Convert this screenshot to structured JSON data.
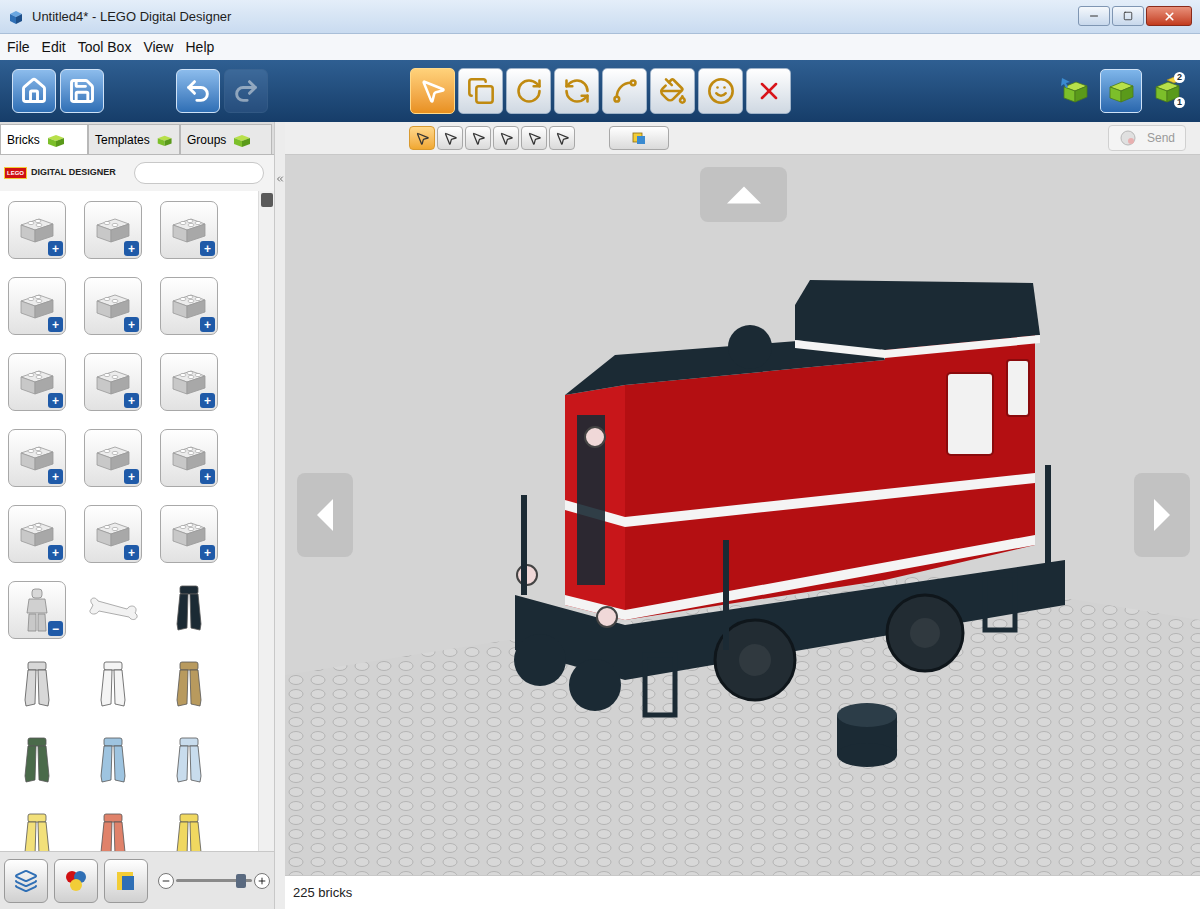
{
  "window": {
    "title": "Untitled4* - LEGO Digital Designer"
  },
  "menu": [
    "File",
    "Edit",
    "Tool Box",
    "View",
    "Help"
  ],
  "toolbar": {
    "actions": [
      {
        "kind": "home",
        "disabled": false
      },
      {
        "kind": "save",
        "disabled": false
      },
      {
        "kind": "undo",
        "disabled": false
      },
      {
        "kind": "redo",
        "disabled": true
      }
    ],
    "tools": [
      {
        "kind": "select",
        "selected": true
      },
      {
        "kind": "clone",
        "selected": false
      },
      {
        "kind": "hinge",
        "selected": false
      },
      {
        "kind": "hinge-align",
        "selected": false
      },
      {
        "kind": "flex",
        "selected": false
      },
      {
        "kind": "paint",
        "selected": false
      },
      {
        "kind": "hide",
        "selected": false
      },
      {
        "kind": "delete",
        "selected": false
      }
    ],
    "modes": [
      {
        "kind": "build",
        "selected": false,
        "badges": []
      },
      {
        "kind": "view",
        "selected": true,
        "badges": []
      },
      {
        "kind": "instructions",
        "selected": false,
        "badges": [
          "2",
          "1"
        ]
      }
    ]
  },
  "selection_modes": [
    {
      "kind": "single",
      "selected": true
    },
    {
      "kind": "connected",
      "selected": false
    },
    {
      "kind": "color",
      "selected": false
    },
    {
      "kind": "shape",
      "selected": false
    },
    {
      "kind": "color-shape",
      "selected": false
    },
    {
      "kind": "invert",
      "selected": false
    },
    {
      "kind": "filter",
      "selected": false
    }
  ],
  "send_button": {
    "label": "Send",
    "disabled": true
  },
  "tabs": [
    {
      "label": "Bricks",
      "selected": true
    },
    {
      "label": "Templates",
      "selected": false
    },
    {
      "label": "Groups",
      "selected": false
    }
  ],
  "brand": {
    "logo": "LEGO",
    "label": "DIGITAL DESIGNER"
  },
  "search": {
    "value": ""
  },
  "palette": [
    {
      "kind": "category",
      "badge": "+",
      "color": "#c8c8c8"
    },
    {
      "kind": "category",
      "badge": "+",
      "color": "#c8c8c8"
    },
    {
      "kind": "category",
      "badge": "+",
      "color": "#c8c8c8"
    },
    {
      "kind": "category",
      "badge": "+",
      "color": "#c8c8c8"
    },
    {
      "kind": "category",
      "badge": "+",
      "color": "#c8c8c8"
    },
    {
      "kind": "category",
      "badge": "+",
      "color": "#c8c8c8"
    },
    {
      "kind": "category",
      "badge": "+",
      "color": "#c8c8c8"
    },
    {
      "kind": "category",
      "badge": "+",
      "color": "#c8c8c8"
    },
    {
      "kind": "category",
      "badge": "+",
      "color": "#c8c8c8"
    },
    {
      "kind": "category",
      "badge": "+",
      "color": "#c8c8c8"
    },
    {
      "kind": "category",
      "badge": "+",
      "color": "#c8c8c8"
    },
    {
      "kind": "category",
      "badge": "+",
      "color": "#c8c8c8"
    },
    {
      "kind": "category",
      "badge": "+",
      "color": "#c8c8c8"
    },
    {
      "kind": "category",
      "badge": "+",
      "color": "#c8c8c8"
    },
    {
      "kind": "category",
      "badge": "+",
      "color": "#c8c8c8"
    },
    {
      "kind": "category",
      "badge": "−",
      "color": "#c8c8c8"
    },
    {
      "kind": "bone",
      "badge": "",
      "color": "#f2f2f2"
    },
    {
      "kind": "part",
      "badge": "",
      "color": "#1b2a34"
    },
    {
      "kind": "part",
      "badge": "",
      "color": "#d8d8d8"
    },
    {
      "kind": "part",
      "badge": "",
      "color": "#f4f4f4"
    },
    {
      "kind": "part",
      "badge": "",
      "color": "#b89a5e"
    },
    {
      "kind": "part",
      "badge": "",
      "color": "#4a6a4a"
    },
    {
      "kind": "part",
      "badge": "",
      "color": "#9ec4e0"
    },
    {
      "kind": "part",
      "badge": "",
      "color": "#c8dced"
    },
    {
      "kind": "part",
      "badge": "",
      "color": "#f2e07a"
    },
    {
      "kind": "part",
      "badge": "",
      "color": "#e0826a"
    },
    {
      "kind": "part",
      "badge": "",
      "color": "#f0d860"
    }
  ],
  "zoom": {
    "level": 0.85
  },
  "status_bar": {
    "text": "225 bricks"
  }
}
